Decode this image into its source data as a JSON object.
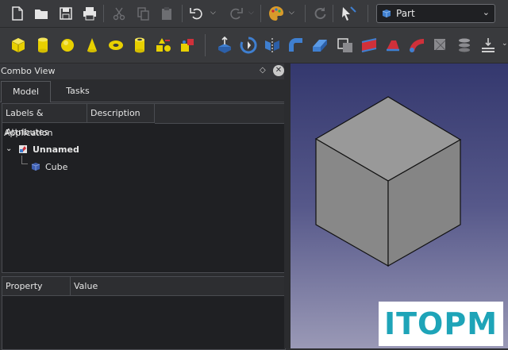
{
  "toolbar": {
    "workbench": "Part",
    "file_icons": [
      "new-document-icon",
      "open-folder-icon",
      "save-icon",
      "print-icon"
    ],
    "edit_icons": [
      "cut-icon",
      "copy-icon",
      "paste-icon"
    ],
    "history_icons": [
      "undo-icon",
      "redo-icon"
    ],
    "misc_icons": [
      "macro-palette-icon",
      "refresh-icon",
      "whats-this-icon"
    ],
    "primitive_icons": [
      "box-icon",
      "cylinder-icon",
      "sphere-icon",
      "cone-icon",
      "torus-icon",
      "tube-icon",
      "primitives-icon",
      "shape-builder-icon"
    ],
    "operation_icons": [
      "extrude-icon",
      "revolve-icon",
      "mirror-icon",
      "fillet-icon",
      "chamfer-icon",
      "make-face-icon",
      "ruled-surface-icon",
      "loft-icon",
      "sweep-icon",
      "section-icon",
      "cross-sections-icon",
      "offset-icon",
      "thickness-icon"
    ]
  },
  "combo_view": {
    "title": "Combo View",
    "tabs": [
      {
        "label": "Model"
      },
      {
        "label": "Tasks"
      }
    ],
    "tree": {
      "columns": [
        "Labels & Attributes",
        "Description"
      ],
      "root_label": "Application",
      "document": "Unnamed",
      "objects": [
        {
          "label": "Cube"
        }
      ]
    },
    "properties": {
      "columns": [
        "Property",
        "Value"
      ]
    }
  },
  "watermark": "ITOPM",
  "colors": {
    "primitive_yellow": "#e8d000",
    "op_blue": "#3f7fd0",
    "op_red": "#d0303a",
    "cube_face": "#878787",
    "view_top": "#34386e",
    "view_bottom": "#9a99b6",
    "watermark_text": "#1ea4b8"
  }
}
